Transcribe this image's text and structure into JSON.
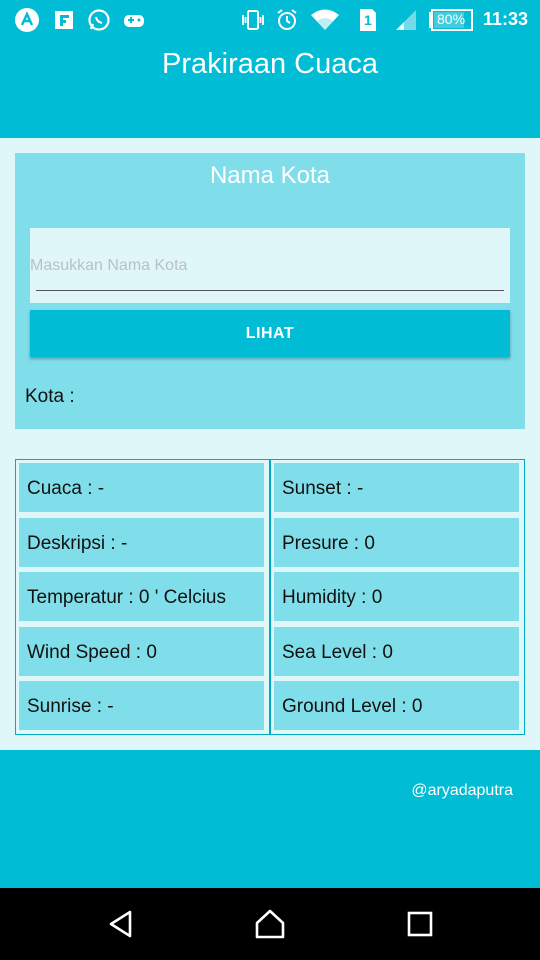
{
  "status_bar": {
    "icons": [
      "notification-a-icon",
      "flipboard-icon",
      "whatsapp-icon",
      "game-controller-icon",
      "vibrate-icon",
      "alarm-icon",
      "wifi-icon",
      "sim-1-icon",
      "signal-icon",
      "battery-icon"
    ],
    "sim_label": "1",
    "battery": "80%",
    "time": "11:33"
  },
  "app": {
    "title": "Prakiraan Cuaca"
  },
  "form": {
    "title": "Nama Kota",
    "input_placeholder": "Masukkan Nama Kota",
    "input_value": "",
    "button_label": "LIHAT",
    "kota_label": "Kota :"
  },
  "results": {
    "left": [
      "Cuaca : -",
      "Deskripsi : -",
      "Temperatur : 0 ' Celcius",
      "Wind Speed : 0",
      "Sunrise : -"
    ],
    "right": [
      "Sunset : -",
      "Presure : 0",
      "Humidity : 0",
      "Sea Level : 0",
      "Ground Level : 0"
    ]
  },
  "footer": {
    "credit": "@aryadaputra"
  },
  "nav": {
    "buttons": [
      "back-icon",
      "home-icon",
      "recents-icon"
    ]
  },
  "colors": {
    "primary": "#00bcd4",
    "card": "#80deea",
    "background": "#e0f7fa"
  }
}
